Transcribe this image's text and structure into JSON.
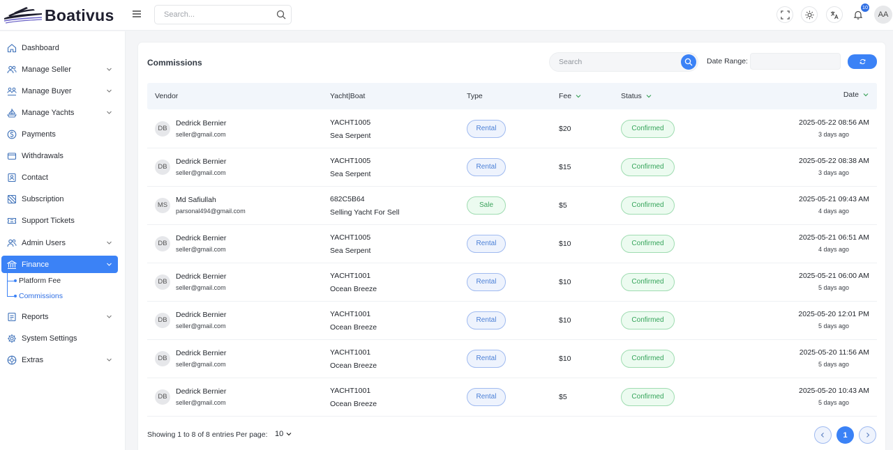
{
  "brand": {
    "name": "Boativus",
    "accent": "#3b82f6"
  },
  "topbar": {
    "search_placeholder": "Search...",
    "notification_count": "10",
    "user_initials": "AA"
  },
  "sidebar": {
    "items": [
      {
        "label": "Dashboard",
        "icon": "home-icon"
      },
      {
        "label": "Manage Seller",
        "icon": "users-icon"
      },
      {
        "label": "Manage Buyer",
        "icon": "buyer-icon"
      },
      {
        "label": "Manage Yachts",
        "icon": "yacht-icon"
      },
      {
        "label": "Payments",
        "icon": "dollar-icon"
      },
      {
        "label": "Withdrawals",
        "icon": "wallet-icon"
      },
      {
        "label": "Contact",
        "icon": "contact-icon"
      },
      {
        "label": "Subscription",
        "icon": "subscription-icon"
      },
      {
        "label": "Support Tickets",
        "icon": "ticket-icon"
      },
      {
        "label": "Admin Users",
        "icon": "admin-users-icon"
      },
      {
        "label": "Finance",
        "icon": "bank-icon"
      },
      {
        "label": "Reports",
        "icon": "report-icon"
      },
      {
        "label": "System Settings",
        "icon": "gear-icon"
      },
      {
        "label": "Extras",
        "icon": "extras-icon"
      }
    ],
    "finance_sub": [
      {
        "label": "Platform Fee"
      },
      {
        "label": "Commissions"
      }
    ]
  },
  "card": {
    "title": "Commissions",
    "search_placeholder": "Search",
    "date_range_label": "Date Range:"
  },
  "table": {
    "headers": {
      "vendor": "Vendor",
      "yacht": "Yacht|Boat",
      "type": "Type",
      "fee": "Fee",
      "status": "Status",
      "date": "Date"
    },
    "rows": [
      {
        "initials": "DB",
        "name": "Dedrick Bernier",
        "email": "seller@gmail.com",
        "code": "YACHT1005",
        "yacht": "Sea Serpent",
        "type": "Rental",
        "fee": "$20",
        "status": "Confirmed",
        "date": "2025-05-22 08:56 AM",
        "ago": "3 days ago"
      },
      {
        "initials": "DB",
        "name": "Dedrick Bernier",
        "email": "seller@gmail.com",
        "code": "YACHT1005",
        "yacht": "Sea Serpent",
        "type": "Rental",
        "fee": "$15",
        "status": "Confirmed",
        "date": "2025-05-22 08:38 AM",
        "ago": "3 days ago"
      },
      {
        "initials": "MS",
        "name": "Md Safiullah",
        "email": "parsonal494@gmail.com",
        "code": "682C5B64",
        "yacht": "Selling Yacht For Sell",
        "type": "Sale",
        "fee": "$5",
        "status": "Confirmed",
        "date": "2025-05-21 09:43 AM",
        "ago": "4 days ago"
      },
      {
        "initials": "DB",
        "name": "Dedrick Bernier",
        "email": "seller@gmail.com",
        "code": "YACHT1005",
        "yacht": "Sea Serpent",
        "type": "Rental",
        "fee": "$10",
        "status": "Confirmed",
        "date": "2025-05-21 06:51 AM",
        "ago": "4 days ago"
      },
      {
        "initials": "DB",
        "name": "Dedrick Bernier",
        "email": "seller@gmail.com",
        "code": "YACHT1001",
        "yacht": "Ocean Breeze",
        "type": "Rental",
        "fee": "$10",
        "status": "Confirmed",
        "date": "2025-05-21 06:00 AM",
        "ago": "5 days ago"
      },
      {
        "initials": "DB",
        "name": "Dedrick Bernier",
        "email": "seller@gmail.com",
        "code": "YACHT1001",
        "yacht": "Ocean Breeze",
        "type": "Rental",
        "fee": "$10",
        "status": "Confirmed",
        "date": "2025-05-20 12:01 PM",
        "ago": "5 days ago"
      },
      {
        "initials": "DB",
        "name": "Dedrick Bernier",
        "email": "seller@gmail.com",
        "code": "YACHT1001",
        "yacht": "Ocean Breeze",
        "type": "Rental",
        "fee": "$10",
        "status": "Confirmed",
        "date": "2025-05-20 11:56 AM",
        "ago": "5 days ago"
      },
      {
        "initials": "DB",
        "name": "Dedrick Bernier",
        "email": "seller@gmail.com",
        "code": "YACHT1001",
        "yacht": "Ocean Breeze",
        "type": "Rental",
        "fee": "$5",
        "status": "Confirmed",
        "date": "2025-05-20 10:43 AM",
        "ago": "5 days ago"
      }
    ]
  },
  "footer": {
    "showing": "Showing 1 to 8 of 8 entries",
    "per_page_label": "Per page:",
    "per_page_value": "10",
    "current_page": "1"
  }
}
